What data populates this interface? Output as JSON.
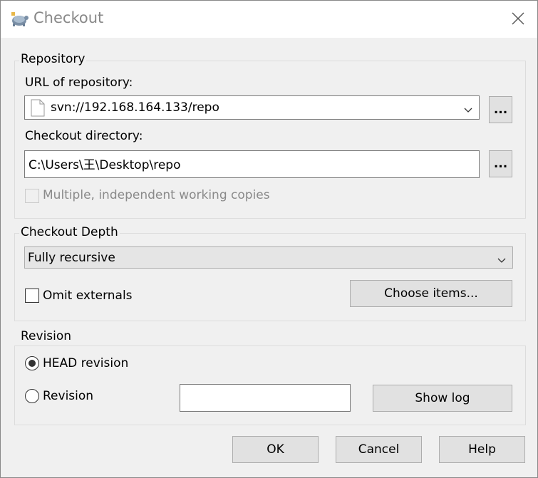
{
  "window": {
    "title": "Checkout",
    "icon": "tortoise-icon",
    "close_icon": "close-icon"
  },
  "repository": {
    "group_title": "Repository",
    "url_label": "URL of repository:",
    "url_value": "svn://192.168.164.133/repo",
    "url_browse": "...",
    "dir_label": "Checkout directory:",
    "dir_value": "C:\\Users\\王\\Desktop\\repo",
    "dir_browse": "...",
    "multi_label": "Multiple, independent working copies",
    "multi_checked": false,
    "multi_enabled": false
  },
  "depth": {
    "group_title": "Checkout Depth",
    "selected": "Fully recursive",
    "omit_label": "Omit externals",
    "omit_checked": false,
    "choose_items": "Choose items..."
  },
  "revision": {
    "group_title": "Revision",
    "head_label": "HEAD revision",
    "head_selected": true,
    "revision_label": "Revision",
    "revision_value": "",
    "show_log": "Show log"
  },
  "buttons": {
    "ok": "OK",
    "cancel": "Cancel",
    "help": "Help"
  }
}
